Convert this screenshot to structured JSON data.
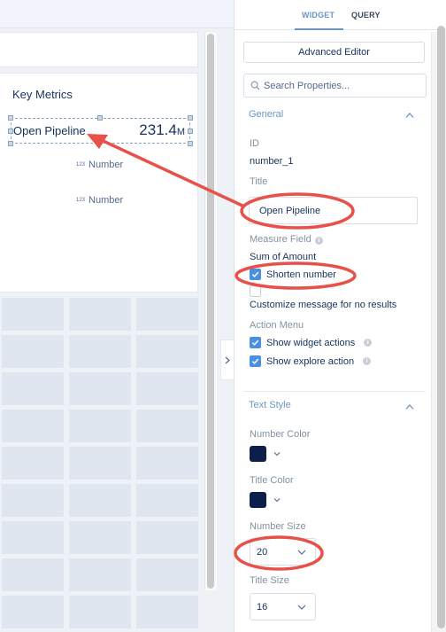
{
  "tabs": [
    {
      "label": "WIDGET",
      "active": true
    },
    {
      "label": "QUERY",
      "active": false
    }
  ],
  "canvas": {
    "container_title": "Key Metrics",
    "selected_widget": {
      "title": "Open Pipeline",
      "value": "231.4",
      "unit": "M"
    },
    "placeholders": [
      {
        "icon_text": "123",
        "label": "Number"
      },
      {
        "icon_text": "123",
        "label": "Number"
      }
    ],
    "collapse_icon": "chevron-right-icon"
  },
  "panel": {
    "advanced_editor_label": "Advanced Editor",
    "search_placeholder": "Search Properties...",
    "general": {
      "heading": "General",
      "id_label": "ID",
      "id_value": "number_1",
      "title_label": "Title",
      "title_value": "Open Pipeline",
      "measure_label": "Measure Field",
      "measure_value": "Sum of Amount",
      "shorten_label": "Shorten number",
      "shorten_checked": true,
      "custom_msg_label": "Customize message for no results",
      "custom_msg_checked": false,
      "action_menu_label": "Action Menu",
      "widget_actions_label": "Show widget actions",
      "widget_actions_checked": true,
      "explore_action_label": "Show explore action",
      "explore_action_checked": true
    },
    "text_style": {
      "heading": "Text Style",
      "number_color_label": "Number Color",
      "number_color": "#0c1f4a",
      "title_color_label": "Title Color",
      "title_color": "#0c1f4a",
      "number_size_label": "Number Size",
      "number_size_value": "20",
      "title_size_label": "Title Size",
      "title_size_value": "16"
    }
  },
  "annotation_color": "#e8504a"
}
